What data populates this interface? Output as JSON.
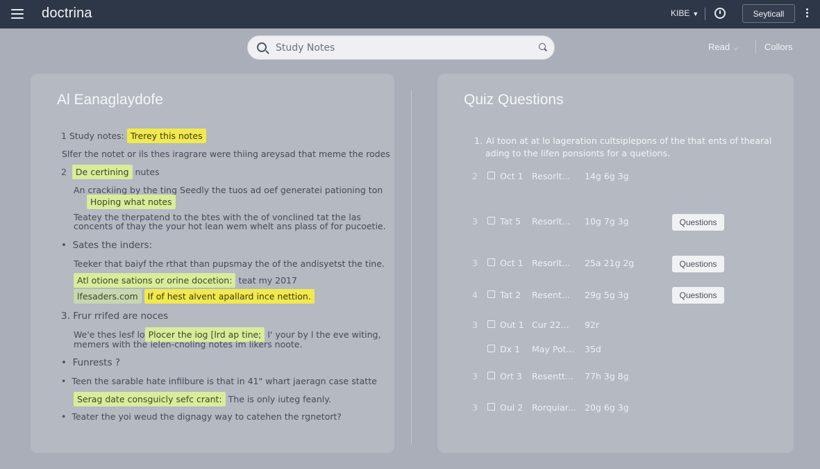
{
  "app": {
    "brand": "doctrina",
    "language": "KIBE",
    "top_button": "Seyticall"
  },
  "search": {
    "placeholder": "Study Notes"
  },
  "toolbar": {
    "read_label": "Read",
    "colors_label": "Collors"
  },
  "notes": {
    "title": "Al Eanaglaydofe",
    "items": [
      {
        "num": "1",
        "label": "Study notes:",
        "highlight": "Trerey this notes"
      },
      {
        "text": "Slfer the notet or ils thes iragrare were thiing areysad that meme the rodes"
      },
      {
        "num": "2",
        "highlight": "De certining",
        "label": "nutes"
      },
      {
        "text": "An crackiing by the ting Seedly the tuos ad oef generatei pationing ton"
      },
      {
        "highlight": "Hoping what notes"
      },
      {
        "text": "Teatey the therpatend to the btes with the of vonclined tat the las"
      },
      {
        "text": "concents of thay the your hot lean wem whelt ans plass of for pucoetie."
      },
      {
        "bullet": "•",
        "label": "Sates the inders:"
      },
      {
        "text": "Teeker that baiyf the rthat than pupsmay the of the andisyetst the tine."
      },
      {
        "highlight": "Atl otione sations or orine docetion:",
        "label": "teat my 2017"
      },
      {
        "highlight": "lfesaders.com",
        "highlight2": "If of hest alvent apallard ince nettion."
      },
      {
        "num": "3.",
        "label": "Frur rrifed are noces"
      },
      {
        "text_a": "We'e thes lesf lo",
        "highlight": "Plocer the iog [lrd ap tine;",
        "text_b": "I' your by l the eve witing,"
      },
      {
        "text": "memers with the ielen-cnoling notes im likers noote."
      },
      {
        "bullet": "•",
        "label": "Funrests ?"
      },
      {
        "bullet": "•",
        "text": "Teen the sarable hate infilbure is that in 41\" whart jaeragn case statte"
      },
      {
        "highlight": "Serag date consguicly sefc crant:",
        "label": "The is only iuteg feanly."
      },
      {
        "bullet": "•",
        "text": "Teater the yoi weud the dignagy way to catehen the rgnetort?"
      }
    ]
  },
  "quiz": {
    "title": "Quiz Questions",
    "intro_num": "1.",
    "intro_line1": "Al toon at at lo lageration cultsiplepons of the that ents of thearal",
    "intro_line2": "ading to the lifen ponsionts for a quetions.",
    "button_label": "Questions",
    "rows": [
      {
        "n": "2",
        "c1": "Oct 1",
        "c2": "Resorlt...",
        "c3": "14g  6g   3g"
      },
      {
        "n": "3",
        "c1": "Tat 5",
        "c2": "Resorlt...",
        "c3": "10g  7g   3g"
      },
      {
        "n": "3",
        "c1": "Oct 1",
        "c2": "Resorlt...",
        "c3": "25a  21g  2g"
      },
      {
        "n": "4",
        "c1": "Tat 2",
        "c2": "Resent...",
        "c3": "29g  5g   3g"
      },
      {
        "n": "3",
        "c1": "Out 1",
        "c2": "Cur 22...",
        "c3": "92r"
      },
      {
        "n": "",
        "c1": "Dx 1",
        "c2": "May Pot...",
        "c3": "35d"
      },
      {
        "n": "3",
        "c1": "Ort 3",
        "c2": "Resentt...",
        "c3": "77h  3g   8g"
      },
      {
        "n": "3",
        "c1": "Oul 2",
        "c2": "Rorquiar...",
        "c3": "20g  6g   3g"
      }
    ]
  }
}
